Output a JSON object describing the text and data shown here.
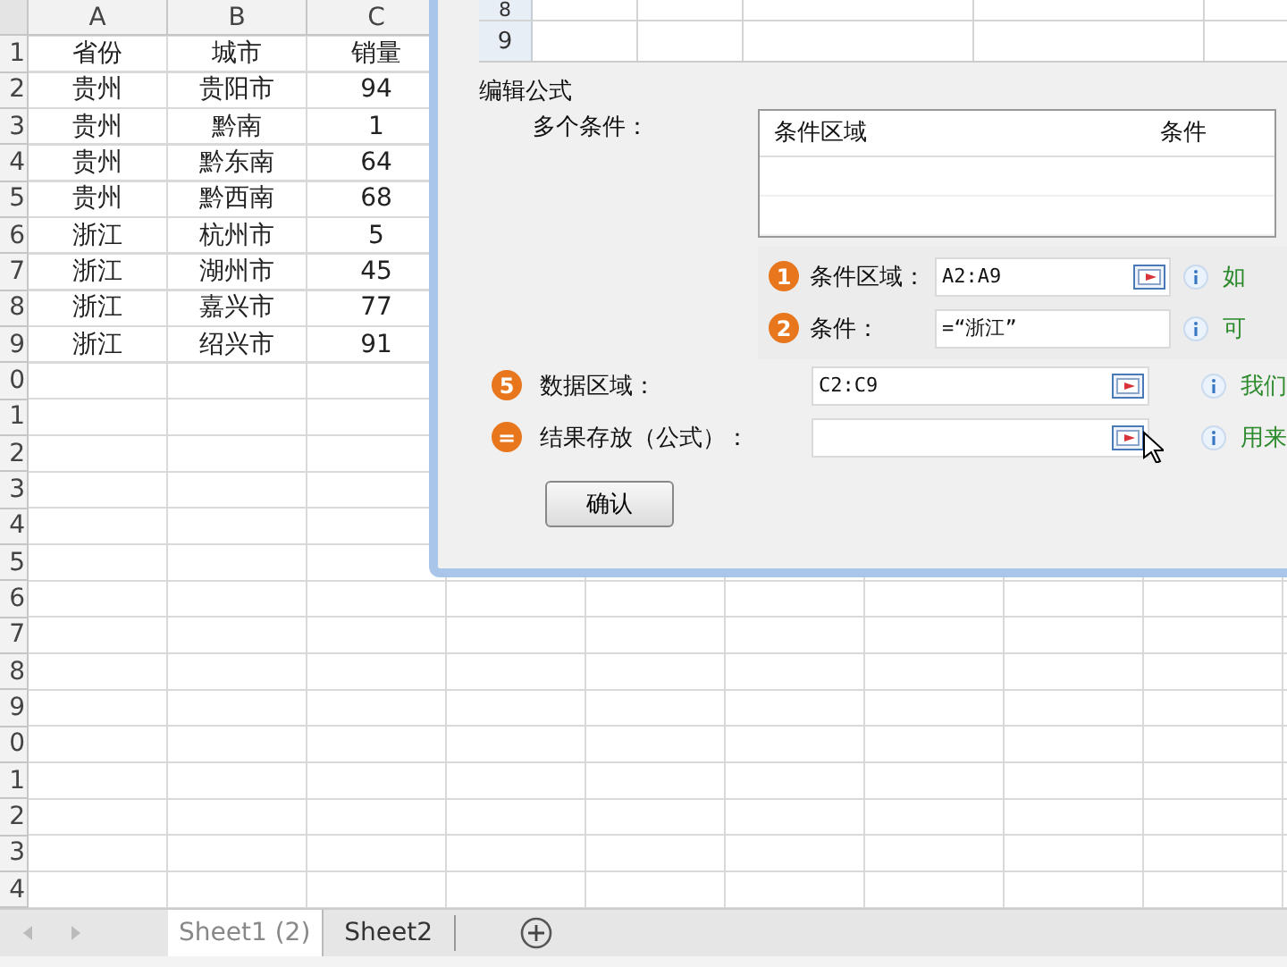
{
  "sheet": {
    "columns": [
      "A",
      "B",
      "C"
    ],
    "row_headers": [
      "1",
      "2",
      "3",
      "4",
      "5",
      "6",
      "7",
      "8",
      "9",
      "0",
      "1",
      "2",
      "3",
      "4",
      "5",
      "6",
      "7",
      "8",
      "9",
      "0",
      "1",
      "2",
      "3",
      "4"
    ],
    "rows": [
      [
        "省份",
        "城市",
        "销量"
      ],
      [
        "贵州",
        "贵阳市",
        "94"
      ],
      [
        "贵州",
        "黔南",
        "1"
      ],
      [
        "贵州",
        "黔东南",
        "64"
      ],
      [
        "贵州",
        "黔西南",
        "68"
      ],
      [
        "浙江",
        "杭州市",
        "5"
      ],
      [
        "浙江",
        "湖州市",
        "45"
      ],
      [
        "浙江",
        "嘉兴市",
        "77"
      ],
      [
        "浙江",
        "绍兴市",
        "91"
      ]
    ]
  },
  "dialog": {
    "grid_rows": [
      "8",
      "9"
    ],
    "title": "编辑公式",
    "multi_label": "多个条件：",
    "table_columns": [
      "条件区域",
      "条件"
    ],
    "conditions": [
      {
        "badge": "1",
        "label": "条件区域：",
        "value": "A2:A9",
        "picker": true,
        "hint": "如"
      },
      {
        "badge": "2",
        "label": "条件：",
        "value": "=“浙江”",
        "picker": false,
        "hint": "可"
      }
    ],
    "fields": [
      {
        "badge": "5",
        "label": "数据区域：",
        "value": "C2:C9",
        "hint": "我们"
      },
      {
        "badge": "=",
        "label": "结果存放（公式）：",
        "hint": "用来"
      }
    ],
    "confirm": "确认"
  },
  "tabs": [
    {
      "label": "Sheet1 (2)",
      "selected": true
    },
    {
      "label": "Sheet2",
      "selected": false
    }
  ]
}
